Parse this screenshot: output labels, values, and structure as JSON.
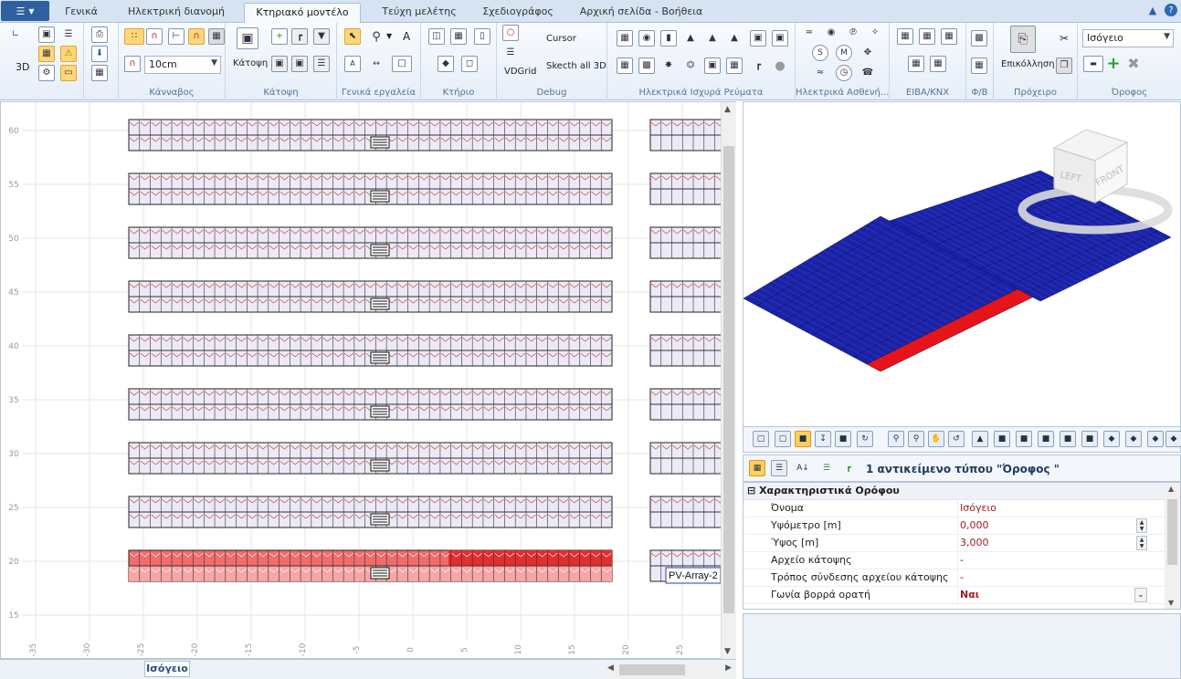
{
  "menu": {
    "icon": "hamburger-menu-icon"
  },
  "tabs": [
    {
      "label": "Γενικά",
      "active": false
    },
    {
      "label": "Ηλεκτρική διανομή",
      "active": false
    },
    {
      "label": "Κτηριακό μοντέλο",
      "active": true
    },
    {
      "label": "Τεύχη μελέτης",
      "active": false
    },
    {
      "label": "Σχεδιογράφος",
      "active": false
    },
    {
      "label": "Αρχική σελίδα - Βοήθεια",
      "active": false
    }
  ],
  "ribbon": {
    "groups": {
      "kanvas": "Κάνναβος",
      "katopsi": "Κάτοψη",
      "general_tools": "Γενικά εργαλεία",
      "ktirio": "Κτήριο",
      "debug": "Debug",
      "strong_current": "Ηλεκτρικά Ισχυρά Ρεύματα",
      "weak_current": "Ηλεκτρικά Ασθενή...",
      "eiba": "EIBA/KNX",
      "fv": "Φ/Β",
      "clipboard": "Πρόχειρο",
      "floor": "Όροφος"
    },
    "label_3d": "3D",
    "grid_size": "10cm",
    "katopsi_label": "Κάτοψη",
    "cursor_label": "Cursor",
    "vdgrid_label": "VDGrid",
    "sketch_label": "Skecth all 3D",
    "paste_label": "Επικόλληση",
    "floor_select": "Ισόγειο"
  },
  "plan": {
    "y_labels": [
      "60",
      "55",
      "50",
      "45",
      "40",
      "35",
      "30",
      "25",
      "20",
      "15"
    ],
    "x_labels": [
      "-35",
      "-30",
      "-25",
      "-20",
      "-15",
      "-10",
      "-5",
      "0",
      "5",
      "10",
      "15",
      "20",
      "25"
    ],
    "rows_count": 9,
    "selected_row": 9,
    "array_label": "PV-Array-2",
    "floor_tab": "Ισόγειο"
  },
  "view3d": {
    "cube_left": "LEFT",
    "cube_front": "FRONT",
    "panel_color": "#1a23a8",
    "selected_color": "#f01010"
  },
  "properties": {
    "title": "1 αντικείμενο τύπου  \"Όροφος \"",
    "category": "Χαρακτηριστικά Ορόφου",
    "rows": [
      {
        "name": "Όνομα",
        "value": "Ισόγειο",
        "style": "red",
        "control": ""
      },
      {
        "name": "Υψόμετρο [m]",
        "value": "0,000",
        "style": "red",
        "control": "spin"
      },
      {
        "name": "Ύψος [m]",
        "value": "3,000",
        "style": "red",
        "control": "spin"
      },
      {
        "name": "Αρχείο κάτοψης",
        "value": "-",
        "style": "",
        "control": ""
      },
      {
        "name": "Τρόπος σύνδεσης αρχείου κάτοψης",
        "value": "-",
        "style": "",
        "control": ""
      },
      {
        "name": "Γωνία βορρά ορατή",
        "value": "Ναι",
        "style": "red bold",
        "control": "dropdown"
      }
    ]
  }
}
